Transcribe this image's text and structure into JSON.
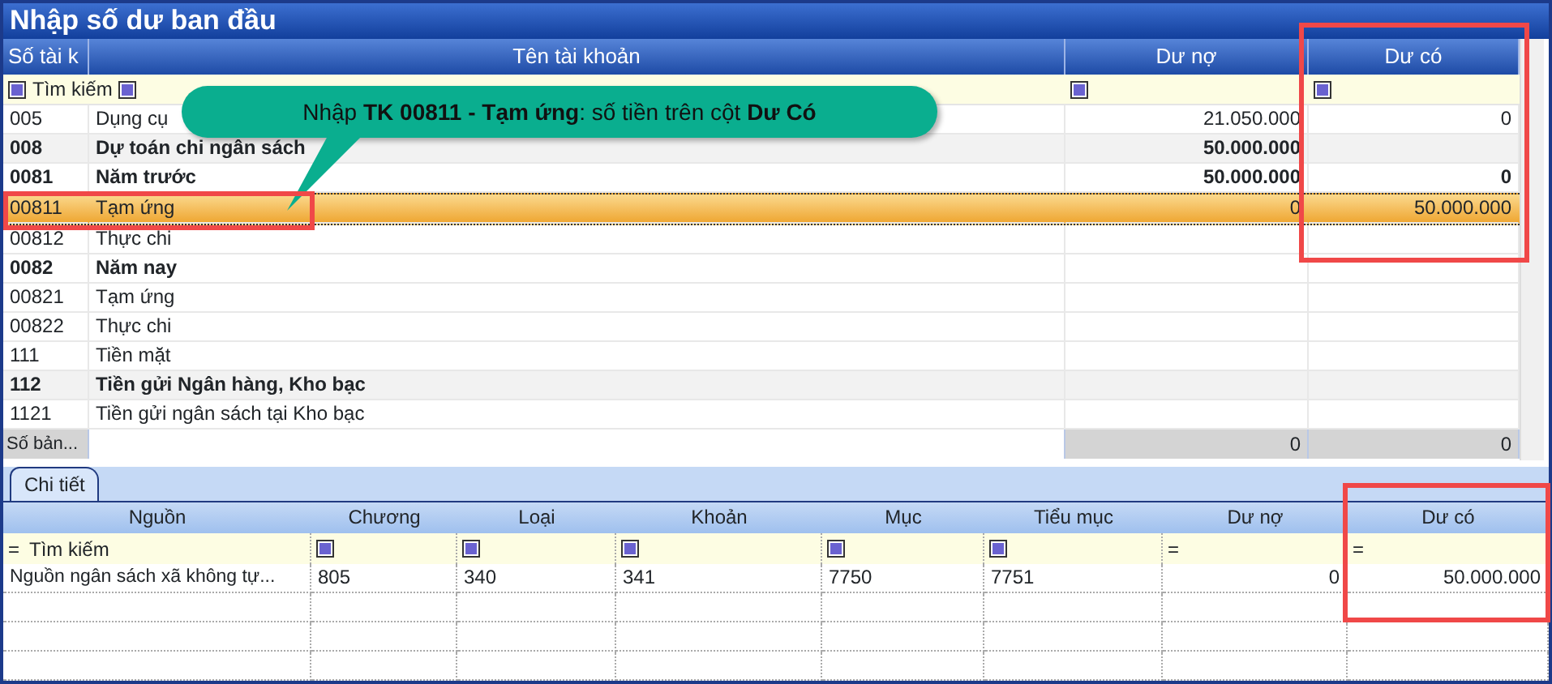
{
  "window": {
    "title": "Nhập số dư ban đầu"
  },
  "accounts": {
    "columns": [
      {
        "label": "Số tài k",
        "highlight": false
      },
      {
        "label": "Tên tài khoản",
        "highlight": false
      },
      {
        "label": "Dư nợ",
        "highlight": false
      },
      {
        "label": "Dư có",
        "highlight": true
      }
    ],
    "filter": [
      {
        "kind": "toggle",
        "text": "Tìm kiếm"
      },
      {
        "kind": "toggle"
      },
      {
        "kind": "toggle"
      },
      {
        "kind": "toggle"
      }
    ],
    "rows": [
      {
        "code": "005",
        "name": "Dụng cụ",
        "debit": "21.050.000",
        "credit": "0",
        "bold": false,
        "shaded": false,
        "selected": false
      },
      {
        "code": "008",
        "name": "Dự toán chi ngân sách",
        "debit": "50.000.000",
        "credit": "",
        "bold": true,
        "shaded": true,
        "selected": false
      },
      {
        "code": "0081",
        "name": "Năm trước",
        "debit": "50.000.000",
        "credit": "0",
        "bold": true,
        "shaded": false,
        "selected": false
      },
      {
        "code": "00811",
        "name": "Tạm ứng",
        "debit": "0",
        "credit": "50.000.000",
        "bold": false,
        "shaded": false,
        "selected": true
      },
      {
        "code": "00812",
        "name": "Thực chi",
        "debit": "",
        "credit": "",
        "bold": false,
        "shaded": false,
        "selected": false
      },
      {
        "code": "0082",
        "name": "Năm nay",
        "debit": "",
        "credit": "",
        "bold": true,
        "shaded": false,
        "selected": false
      },
      {
        "code": "00821",
        "name": "Tạm ứng",
        "debit": "",
        "credit": "",
        "bold": false,
        "shaded": false,
        "selected": false
      },
      {
        "code": "00822",
        "name": "Thực chi",
        "debit": "",
        "credit": "",
        "bold": false,
        "shaded": false,
        "selected": false
      },
      {
        "code": "111",
        "name": "Tiền mặt",
        "debit": "",
        "credit": "",
        "bold": false,
        "shaded": false,
        "selected": false
      },
      {
        "code": "112",
        "name": "Tiền gửi Ngân hàng, Kho bạc",
        "debit": "",
        "credit": "",
        "bold": true,
        "shaded": true,
        "selected": false
      },
      {
        "code": "1121",
        "name": "Tiền gửi ngân sách tại Kho bạc",
        "debit": "",
        "credit": "",
        "bold": false,
        "shaded": false,
        "selected": false
      }
    ],
    "footer": {
      "label": "Số bản...",
      "debit": "0",
      "credit": "0"
    }
  },
  "callout": {
    "text": "Nhập **TK 00811 - Tạm ứng**: số tiền trên cột **Dư Có**"
  },
  "detail": {
    "tabs": [
      {
        "label": "Chi tiết",
        "selected": true
      }
    ],
    "columns": [
      {
        "label": "Nguồn",
        "highlight": false
      },
      {
        "label": "Chương",
        "highlight": false
      },
      {
        "label": "Loại",
        "highlight": false
      },
      {
        "label": "Khoản",
        "highlight": false
      },
      {
        "label": "Mục",
        "highlight": false
      },
      {
        "label": "Tiểu mục",
        "highlight": false
      },
      {
        "label": "Dư nợ",
        "highlight": false
      },
      {
        "label": "Dư có",
        "highlight": true
      }
    ],
    "filter": [
      {
        "kind": "operator",
        "op": "=",
        "text": "Tìm kiếm"
      },
      {
        "kind": "toggle"
      },
      {
        "kind": "toggle"
      },
      {
        "kind": "toggle"
      },
      {
        "kind": "toggle"
      },
      {
        "kind": "toggle"
      },
      {
        "kind": "operator",
        "op": "="
      },
      {
        "kind": "operator",
        "op": "="
      }
    ],
    "rows": [
      [
        "Nguồn ngân sách xã không tự...",
        "805",
        "340",
        "341",
        "7750",
        "7751",
        "0",
        "50.000.000"
      ]
    ]
  }
}
